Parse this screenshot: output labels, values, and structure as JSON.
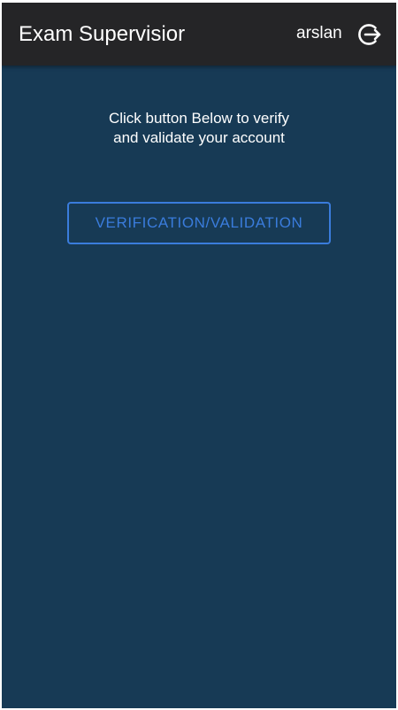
{
  "header": {
    "title": "Exam Supervisior",
    "username": "arslan",
    "logout_icon": "logout-icon"
  },
  "main": {
    "instruction_line1": "Click button Below to verify",
    "instruction_line2": "and validate your account",
    "verify_button_label": "VERIFICATION/VALIDATION"
  },
  "colors": {
    "header_bg": "#252527",
    "page_bg": "#173a55",
    "accent": "#3a7cdc",
    "text": "#ffffff"
  }
}
